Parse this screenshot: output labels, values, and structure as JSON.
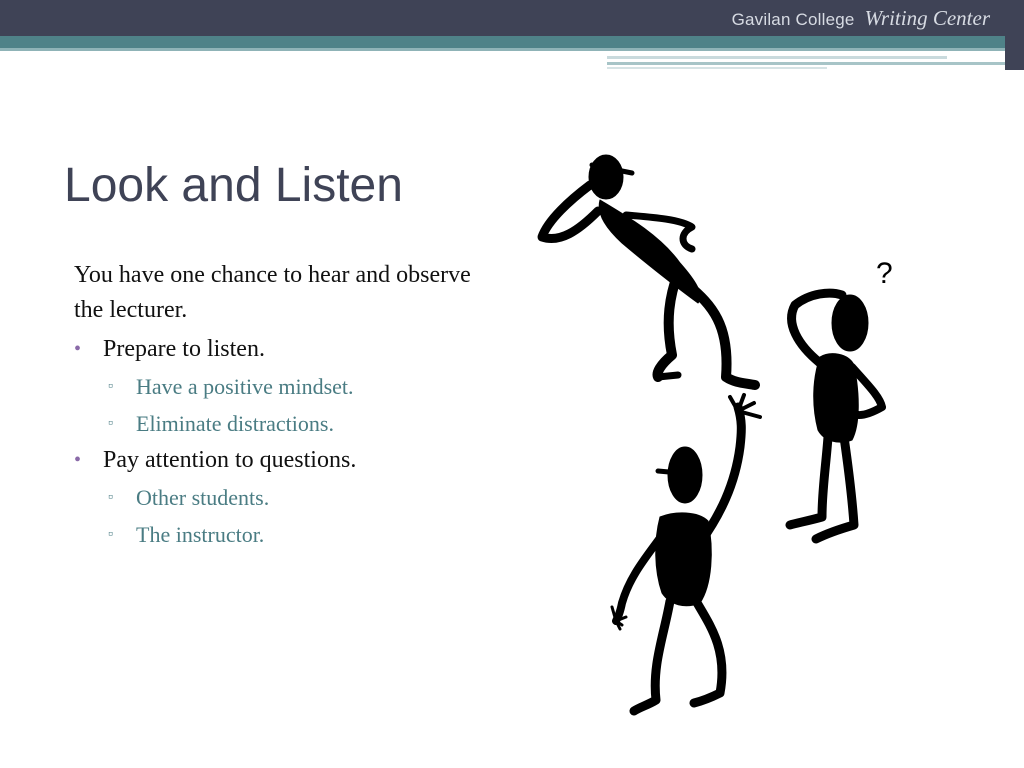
{
  "header": {
    "college": "Gavilan College",
    "center": "Writing Center"
  },
  "slide": {
    "title": "Look and Listen",
    "intro": "You have one chance to hear and observe the lecturer.",
    "bullets": [
      {
        "text": "Prepare to listen.",
        "subs": [
          "Have a positive mindset.",
          "Eliminate distractions."
        ]
      },
      {
        "text": "Pay attention to questions.",
        "subs": [
          "Other students.",
          "The instructor."
        ]
      }
    ]
  },
  "illustration": {
    "question_mark": "?"
  },
  "colors": {
    "header_dark": "#3f4356",
    "header_teal": "#4f8288",
    "title": "#3f4356",
    "bullet_dot": "#8a6aa8",
    "sub_text": "#4a7c83"
  }
}
